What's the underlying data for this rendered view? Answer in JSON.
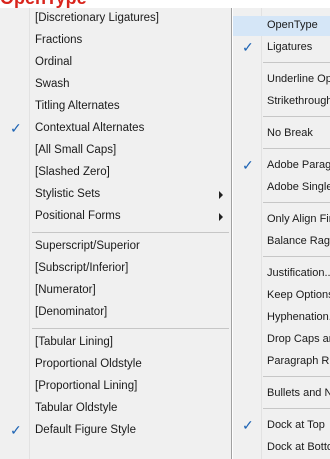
{
  "banner": "OpenType",
  "submenu": {
    "items": [
      {
        "label": "[Discretionary Ligatures]",
        "checked": false
      },
      {
        "label": "Fractions",
        "checked": false
      },
      {
        "label": "Ordinal",
        "checked": false
      },
      {
        "label": "Swash",
        "checked": false
      },
      {
        "label": "Titling Alternates",
        "checked": false
      },
      {
        "label": "Contextual Alternates",
        "checked": true
      },
      {
        "label": "[All Small Caps]",
        "checked": false
      },
      {
        "label": "[Slashed Zero]",
        "checked": false
      },
      {
        "label": "Stylistic Sets",
        "checked": false
      },
      {
        "label": "Positional Forms",
        "checked": false
      },
      {
        "label": "Superscript/Superior",
        "checked": false
      },
      {
        "label": "[Subscript/Inferior]",
        "checked": false
      },
      {
        "label": "[Numerator]",
        "checked": false
      },
      {
        "label": "[Denominator]",
        "checked": false
      },
      {
        "label": "[Tabular Lining]",
        "checked": false
      },
      {
        "label": "Proportional Oldstyle",
        "checked": false
      },
      {
        "label": "[Proportional Lining]",
        "checked": false
      },
      {
        "label": "Tabular Oldstyle",
        "checked": false
      },
      {
        "label": "Default Figure Style",
        "checked": true
      }
    ],
    "checkmark": "✓"
  },
  "mainmenu": {
    "items": [
      {
        "label": "OpenType",
        "checked": false
      },
      {
        "label": "Ligatures",
        "checked": true
      },
      {
        "label": "Underline Options...",
        "checked": false
      },
      {
        "label": "Strikethrough Options...",
        "checked": false
      },
      {
        "label": "No Break",
        "checked": false
      },
      {
        "label": "Adobe Paragraph Composer",
        "checked": true
      },
      {
        "label": "Adobe Single-line Composer",
        "checked": false
      },
      {
        "label": "Only Align First Line to Grid",
        "checked": false
      },
      {
        "label": "Balance Ragged Lines",
        "checked": false
      },
      {
        "label": "Justification...",
        "checked": false
      },
      {
        "label": "Keep Options...",
        "checked": false
      },
      {
        "label": "Hyphenation...",
        "checked": false
      },
      {
        "label": "Drop Caps and Nested Styles...",
        "checked": false
      },
      {
        "label": "Paragraph Rules...",
        "checked": false
      },
      {
        "label": "Bullets and Numbering...",
        "checked": false
      },
      {
        "label": "Dock at Top",
        "checked": true
      },
      {
        "label": "Dock at Bottom",
        "checked": false
      }
    ]
  }
}
